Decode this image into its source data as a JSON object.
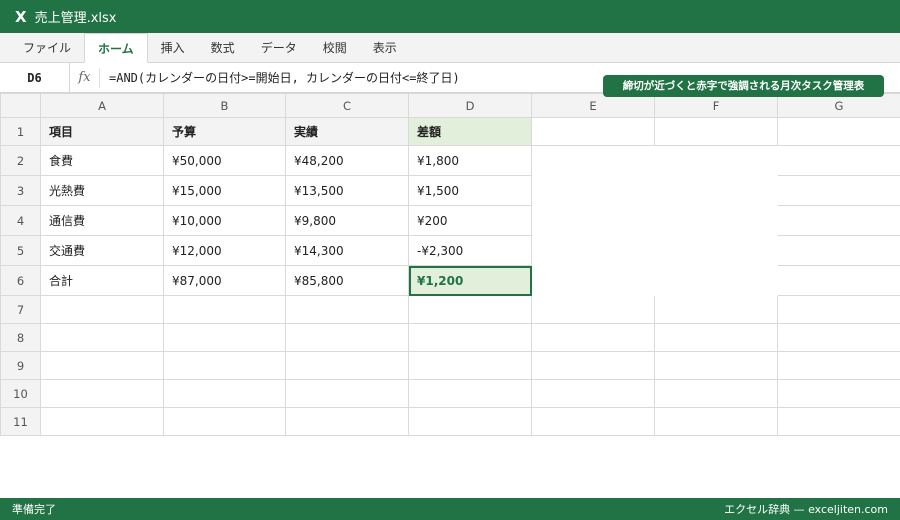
{
  "window": {
    "app_icon": "X",
    "title": "売上管理.xlsx"
  },
  "ribbon": {
    "tabs": [
      {
        "label": "ファイル"
      },
      {
        "label": "ホーム",
        "active": true
      },
      {
        "label": "挿入"
      },
      {
        "label": "数式"
      },
      {
        "label": "データ"
      },
      {
        "label": "校閲"
      },
      {
        "label": "表示"
      }
    ]
  },
  "formula_bar": {
    "name_box": "D6",
    "fx": "fx",
    "formula": "=AND(カレンダーの日付>=開始日, カレンダーの日付<=終了日)"
  },
  "callout": "締切が近づくと赤字で強調される月次タスク管理表",
  "sheet": {
    "columns": [
      "A",
      "B",
      "C",
      "D",
      "E",
      "F",
      "G"
    ],
    "rows": [
      "1",
      "2",
      "3",
      "4",
      "5",
      "6",
      "7",
      "8",
      "9",
      "10",
      "11"
    ],
    "header": [
      "項目",
      "予算",
      "実績",
      "差額"
    ],
    "data": [
      [
        "食費",
        "¥50,000",
        "¥48,200",
        "¥1,800"
      ],
      [
        "光熱費",
        "¥15,000",
        "¥13,500",
        "¥1,500"
      ],
      [
        "通信費",
        "¥10,000",
        "¥9,800",
        "¥200"
      ],
      [
        "交通費",
        "¥12,000",
        "¥14,300",
        "-¥2,300"
      ],
      [
        "合計",
        "¥87,000",
        "¥85,800",
        "¥1,200"
      ]
    ],
    "selected_cell": "D6"
  },
  "status": {
    "left": "準備完了",
    "right": "エクセル辞典 — exceljiten.com"
  },
  "colors": {
    "accent": "#217346",
    "header_bg": "#f3f3f3",
    "highlight_bg": "#e2efda",
    "grid": "#d9d9d9"
  }
}
